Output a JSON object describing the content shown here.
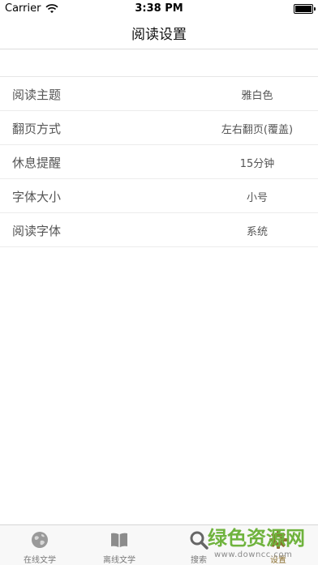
{
  "status_bar": {
    "carrier": "Carrier",
    "time": "3:38 PM",
    "battery_fraction": 1.0
  },
  "nav": {
    "title": "阅读设置"
  },
  "settings": [
    {
      "label": "阅读主题",
      "value": "雅白色"
    },
    {
      "label": "翻页方式",
      "value": "左右翻页(覆盖)"
    },
    {
      "label": "休息提醒",
      "value": "15分钟"
    },
    {
      "label": "字体大小",
      "value": "小号"
    },
    {
      "label": "阅读字体",
      "value": "系统"
    }
  ],
  "tabs": [
    {
      "label": "在线文学",
      "icon": "globe-icon"
    },
    {
      "label": "离线文学",
      "icon": "book-icon"
    },
    {
      "label": "搜索",
      "icon": "search-icon"
    },
    {
      "label": "设置",
      "icon": "gear-icon",
      "active": true
    }
  ],
  "watermark": {
    "brand": "绿色资源网",
    "url": "www.downcc.com"
  },
  "colors": {
    "active_tab": "#8b6f2f",
    "inactive_tab": "#777777",
    "watermark": "#6fb33d"
  }
}
